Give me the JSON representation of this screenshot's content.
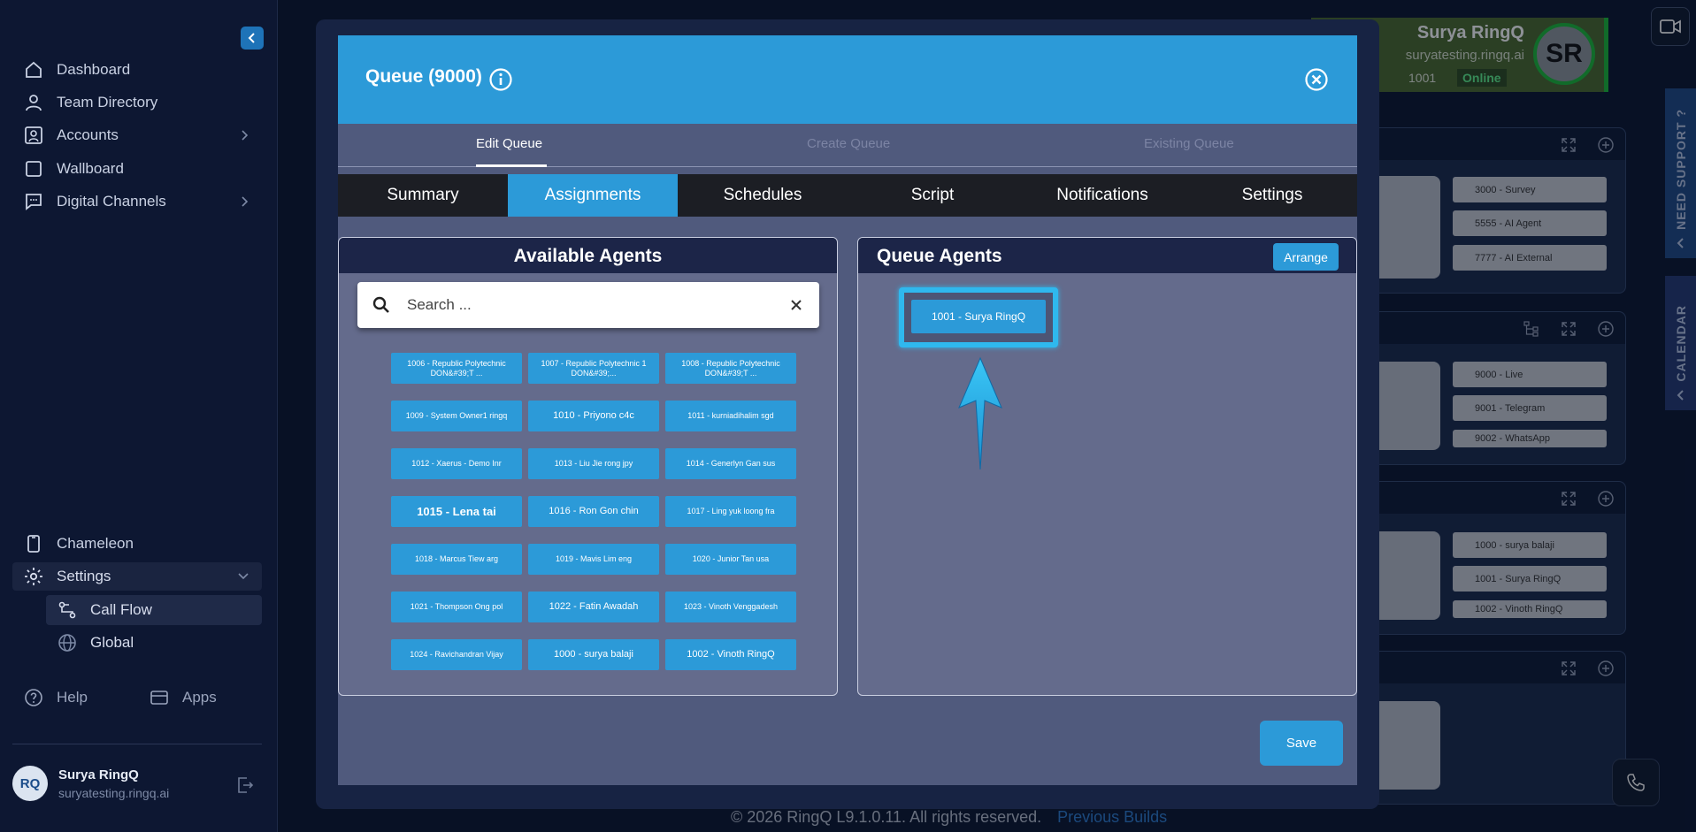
{
  "sidebar": {
    "nav": [
      {
        "label": "Dashboard",
        "icon": "home-icon"
      },
      {
        "label": "Team Directory",
        "icon": "person-icon"
      },
      {
        "label": "Accounts",
        "icon": "account-icon",
        "has_submenu": true
      },
      {
        "label": "Wallboard",
        "icon": "square-icon"
      },
      {
        "label": "Digital Channels",
        "icon": "chat-icon",
        "has_submenu": true
      }
    ],
    "lower": [
      {
        "label": "Chameleon",
        "icon": "device-icon"
      },
      {
        "label": "Settings",
        "icon": "gear-icon",
        "expanded": true
      }
    ],
    "settings_children": [
      {
        "label": "Call Flow",
        "icon": "call-flow-icon",
        "active": true
      },
      {
        "label": "Global",
        "icon": "globe-icon"
      }
    ],
    "help_label": "Help",
    "apps_label": "Apps",
    "user": {
      "initials": "RQ",
      "name": "Surya RingQ",
      "domain": "suryatesting.ringq.ai"
    }
  },
  "profile": {
    "name": "Surya RingQ",
    "domain": "suryatesting.ringq.ai",
    "extension": "1001",
    "status": "Online",
    "initials": "SR",
    "status_color": "#1dbb3a"
  },
  "side_tabs": {
    "support": "NEED SUPPORT ?",
    "calendar": "CALENDAR"
  },
  "background_chips": [
    "3000 - Survey",
    "5555 - AI Agent",
    "7777 - AI External",
    "9000 - Live",
    "9001 - Telegram",
    "9002 - WhatsApp",
    "1000 - surya balaji",
    "1001 - Surya RingQ",
    "1002 - Vinoth RingQ"
  ],
  "footer": {
    "copyright": "© 2026 RingQ L9.1.0.11. All rights reserved.",
    "link": "Previous Builds"
  },
  "modal": {
    "title": "Queue (9000)",
    "steps": [
      "Edit Queue",
      "Create Queue",
      "Existing Queue"
    ],
    "active_step": "Edit Queue",
    "tabs": [
      "Summary",
      "Assignments",
      "Schedules",
      "Script",
      "Notifications",
      "Settings"
    ],
    "active_tab": "Assignments",
    "available": {
      "title": "Available Agents",
      "search_placeholder": "Search ...",
      "agents": [
        {
          "label": "1006 - Republic Polytechnic DON&#39;T ...",
          "size": "sm"
        },
        {
          "label": "1007 - Republic Polytechnic 1 DON&#39;...",
          "size": "sm"
        },
        {
          "label": "1008 - Republic Polytechnic DON&#39;T ...",
          "size": "sm"
        },
        {
          "label": "1009 - System Owner1 ringq",
          "size": "sm"
        },
        {
          "label": "1010 - Priyono c4c",
          "size": "md"
        },
        {
          "label": "1011 - kurniadihalim sgd",
          "size": "sm"
        },
        {
          "label": "1012 - Xaerus - Demo Inr",
          "size": "sm"
        },
        {
          "label": "1013 - Liu Jie rong jpy",
          "size": "sm"
        },
        {
          "label": "1014 - Generlyn Gan sus",
          "size": "sm"
        },
        {
          "label": "1015 - Lena tai",
          "size": "lg"
        },
        {
          "label": "1016 - Ron Gon chin",
          "size": "md"
        },
        {
          "label": "1017 - Ling yuk loong fra",
          "size": "sm"
        },
        {
          "label": "1018 - Marcus Tiew arg",
          "size": "sm"
        },
        {
          "label": "1019 - Mavis Lim eng",
          "size": "sm"
        },
        {
          "label": "1020 - Junior Tan usa",
          "size": "sm"
        },
        {
          "label": "1021 - Thompson Ong pol",
          "size": "sm"
        },
        {
          "label": "1022 - Fatin Awadah",
          "size": "md"
        },
        {
          "label": "1023 - Vinoth Venggadesh",
          "size": "sm"
        },
        {
          "label": "1024 - Ravichandran Vijay",
          "size": "sm"
        },
        {
          "label": "1000 - surya balaji",
          "size": "md"
        },
        {
          "label": "1002 - Vinoth RingQ",
          "size": "md"
        }
      ]
    },
    "queue": {
      "title": "Queue Agents",
      "arrange_label": "Arrange",
      "agents": [
        "1001 - Surya RingQ"
      ]
    },
    "save_label": "Save"
  },
  "colors": {
    "accent": "#2c9ad8",
    "highlight": "#2fb8ee",
    "online": "#1dbb3a"
  }
}
